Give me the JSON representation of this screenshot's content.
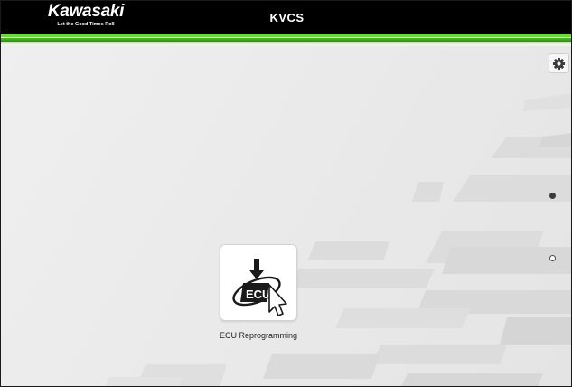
{
  "header": {
    "brand": "Kawasaki",
    "tagline": "Let the Good Times Roll",
    "title": "KVCS"
  },
  "main": {
    "settings_icon": "gear-icon",
    "tiles": [
      {
        "label": "ECU Reprogramming",
        "icon": "ecu-reprogramming-icon",
        "icon_text": "ECU"
      }
    ],
    "pagination": {
      "pages": 2,
      "active": 1
    }
  },
  "colors": {
    "header_bg": "#000000",
    "brand_green": "#4cb528",
    "background": "#e9e9e9",
    "tile_bg": "#ffffff"
  }
}
